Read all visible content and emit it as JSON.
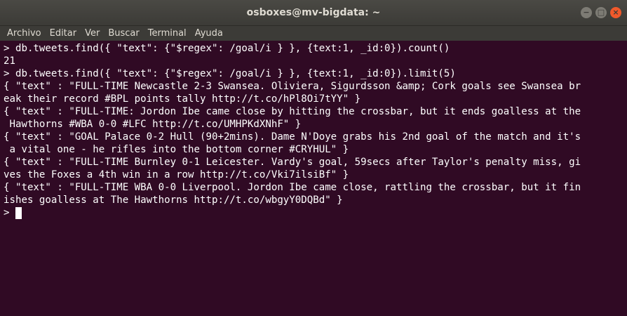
{
  "window": {
    "title": "osboxes@mv-bigdata: ~",
    "buttons": {
      "minimize": "−",
      "maximize": "□",
      "close": "×"
    }
  },
  "menu": [
    "Archivo",
    "Editar",
    "Ver",
    "Buscar",
    "Terminal",
    "Ayuda"
  ],
  "terminal": {
    "lines": [
      "> db.tweets.find({ \"text\": {\"$regex\": /goal/i } }, {text:1, _id:0}).count()",
      "21",
      "> db.tweets.find({ \"text\": {\"$regex\": /goal/i } }, {text:1, _id:0}).limit(5)",
      "{ \"text\" : \"FULL-TIME Newcastle 2-3 Swansea. Oliviera, Sigurdsson &amp; Cork goals see Swansea br",
      "eak their record #BPL points tally http://t.co/hPl8Oi7tYY\" }",
      "{ \"text\" : \"FULL-TIME: Jordon Ibe came close by hitting the crossbar, but it ends goalless at the",
      " Hawthorns #WBA 0-0 #LFC http://t.co/UMHPKdXNhF\" }",
      "{ \"text\" : \"GOAL Palace 0-2 Hull (90+2mins). Dame N'Doye grabs his 2nd goal of the match and it's",
      " a vital one - he rifles into the bottom corner #CRYHUL\" }",
      "{ \"text\" : \"FULL-TIME Burnley 0-1 Leicester. Vardy's goal, 59secs after Taylor's penalty miss, gi",
      "ves the Foxes a 4th win in a row http://t.co/Vki7ilsiBf\" }",
      "{ \"text\" : \"FULL-TIME WBA 0-0 Liverpool. Jordon Ibe came close, rattling the crossbar, but it fin",
      "ishes goalless at The Hawthorns http://t.co/wbgyY0DQBd\" }"
    ],
    "prompt": ">"
  }
}
